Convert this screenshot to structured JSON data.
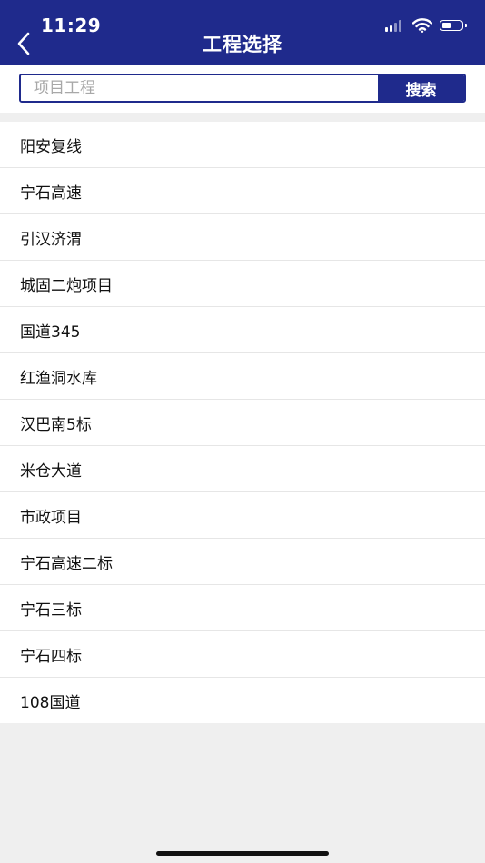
{
  "status_bar": {
    "time": "11:29"
  },
  "header": {
    "title": "工程选择",
    "back_icon": "chevron-left-icon",
    "background_color": "#1f2a8c"
  },
  "search": {
    "placeholder": "项目工程",
    "value": "",
    "button_label": "搜索"
  },
  "projects": [
    "阳安复线",
    "宁石高速",
    "引汉济渭",
    "城固二炮项目",
    "国道345",
    "红渔洞水库",
    "汉巴南5标",
    "米仓大道",
    "市政项目",
    "宁石高速二标",
    "宁石三标",
    "宁石四标",
    "108国道"
  ]
}
